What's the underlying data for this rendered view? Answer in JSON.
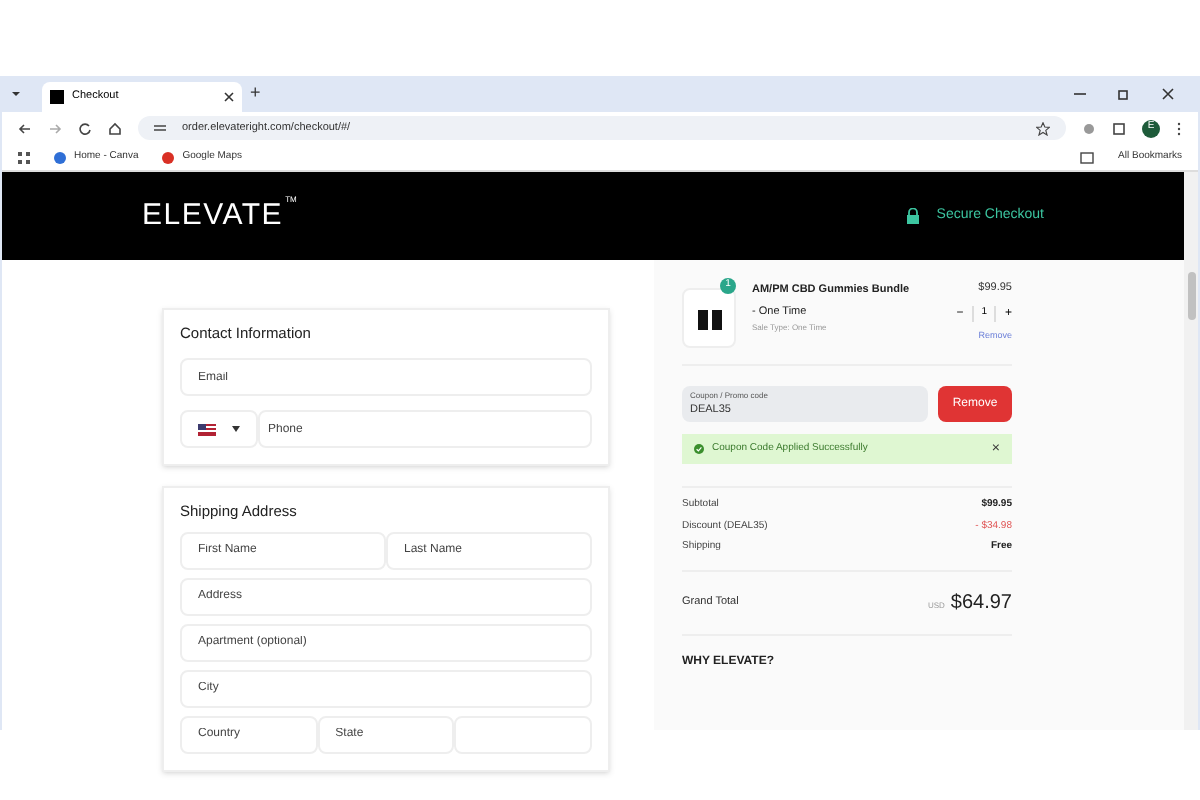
{
  "browser": {
    "tab_title": "Checkout",
    "new_tab": "+",
    "url": "order.elevateright.com/checkout/#/",
    "bookmarks": [
      {
        "label": "Home - Canva",
        "color": "#2f6fd6"
      },
      {
        "label": "Google Maps",
        "color": "#d93025"
      }
    ],
    "all_bookmarks": "All Bookmarks",
    "profile_initial": "E"
  },
  "header": {
    "logo": "ELEVATE",
    "logo_mark": "TM",
    "secure": "Secure Checkout"
  },
  "contact": {
    "title": "Contact Information",
    "fields": [
      {
        "placeholder": "Email",
        "kind": "text"
      },
      {
        "placeholder": "Phone",
        "kind": "phone"
      }
    ]
  },
  "shipping": {
    "title": "Shipping Address",
    "rows": [
      [
        {
          "placeholder": "First Name"
        },
        {
          "placeholder": "Last Name"
        }
      ],
      [
        {
          "placeholder": "Address"
        }
      ],
      [
        {
          "placeholder": "Apartment (optional)"
        }
      ],
      [
        {
          "placeholder": "City"
        }
      ],
      [
        {
          "placeholder": "Country"
        },
        {
          "placeholder": "State"
        },
        {}
      ]
    ]
  },
  "cart": {
    "item": {
      "badge": "1",
      "name": "AM/PM CBD Gummies Bundle",
      "variant": "- One Time",
      "sale_type": "Sale Type: One Time",
      "price": "$99.95",
      "minus": "−",
      "quantity": "1",
      "plus": "+",
      "remove": "Remove"
    },
    "coupon": {
      "label": "Coupon / Promo code",
      "value": "DEAL35",
      "button": "Remove"
    },
    "notice": {
      "text": "Coupon Code Applied Successfully",
      "close": "×"
    },
    "totals": [
      {
        "label": "Subtotal",
        "value": "$99.95",
        "kind": "normal"
      },
      {
        "label": "Discount (DEAL35)",
        "value": "- $34.98",
        "kind": "discount"
      },
      {
        "label": "Shipping",
        "value": "Free",
        "kind": "normal"
      }
    ],
    "grand_total": {
      "label": "Grand Total",
      "currency": "USD",
      "value": "$64.97"
    },
    "why": "WHY ELEVATE?"
  }
}
